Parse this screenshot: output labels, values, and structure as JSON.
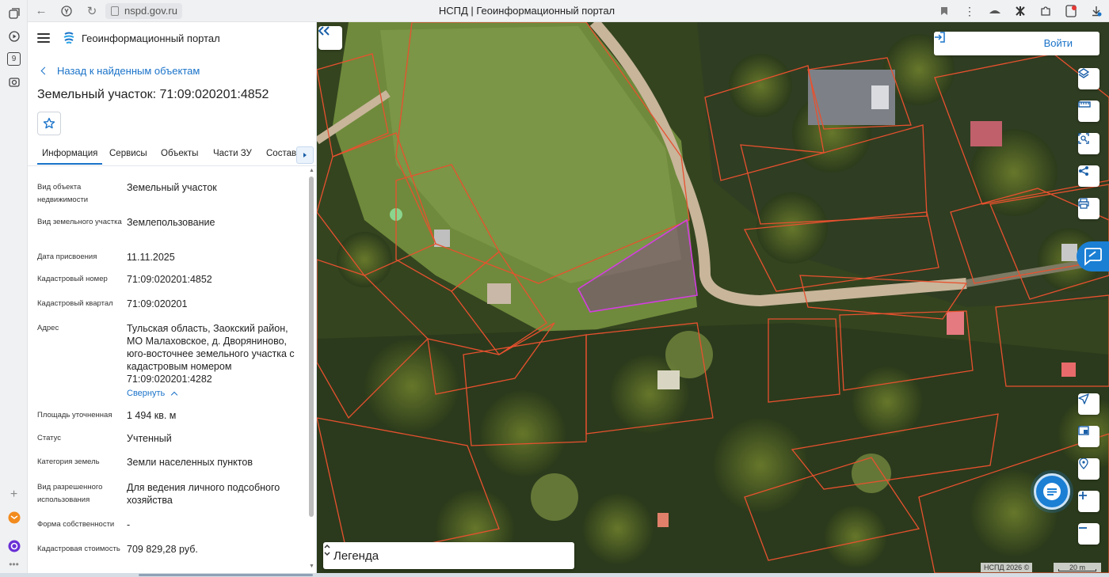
{
  "browser": {
    "url": "nspd.gov.ru",
    "window_title": "НСПД | Геоинформационный портал",
    "sidebar_counter": "9"
  },
  "header": {
    "portal_name": "Геоинформационный портал"
  },
  "panel": {
    "back_label": "Назад к найденным объектам",
    "title": "Земельный участок: 71:09:020201:4852",
    "tabs": [
      {
        "label": "Информация"
      },
      {
        "label": "Сервисы"
      },
      {
        "label": "Объекты"
      },
      {
        "label": "Части ЗУ"
      },
      {
        "label": "Состав"
      }
    ],
    "rows": [
      {
        "label": "Вид объекта недвижимости",
        "value": "Земельный участок"
      },
      {
        "label": "Вид земельного участка",
        "value": "Землепользование"
      },
      {
        "label": "Дата присвоения",
        "value": "11.11.2025"
      },
      {
        "label": "Кадастровый номер",
        "value": "71:09:020201:4852"
      },
      {
        "label": "Кадастровый квартал",
        "value": "71:09:020201"
      },
      {
        "label": "Адрес",
        "value": "Тульская область, Заокский район, МО Малаховское, д. Дворяниново, юго-восточнее земельного участка с кадастровым номером 71:09:020201:4282"
      },
      {
        "label": "Площадь уточненная",
        "value": "1 494 кв. м"
      },
      {
        "label": "Статус",
        "value": "Учтенный"
      },
      {
        "label": "Категория земель",
        "value": "Земли населенных пунктов"
      },
      {
        "label": "Вид разрешенного использования",
        "value": "Для ведения личного подсобного хозяйства"
      },
      {
        "label": "Форма собственности",
        "value": "-"
      },
      {
        "label": "Кадастровая стоимость",
        "value": "709 829,28 руб."
      }
    ],
    "collapse_label": "Свернуть"
  },
  "map": {
    "login_label": "Войти",
    "legend_label": "Легенда",
    "attribution": "НСПД 2026 ©",
    "scale_label": "20 m",
    "tools": [
      "layers-icon",
      "ruler-icon",
      "select-area-icon",
      "share-icon",
      "print-icon"
    ],
    "controls": [
      "geolocation-icon",
      "minimap-icon",
      "location-search-icon",
      "zoom-in-icon",
      "zoom-out-icon"
    ],
    "colors": {
      "parcel_border": "#e8512f",
      "selected_parcel": "#c63ad0",
      "accent": "#1a73c9"
    }
  }
}
